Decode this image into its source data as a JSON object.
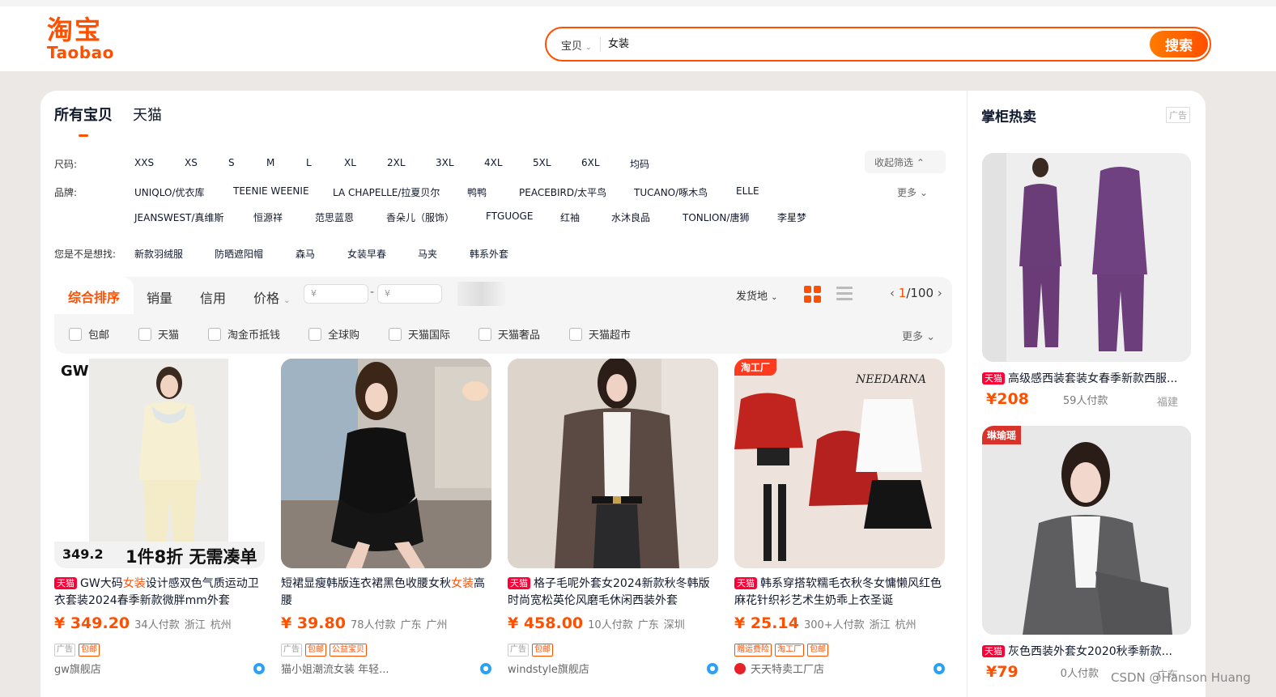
{
  "header": {
    "logo_cn": "淘宝",
    "logo_en": "Taobao",
    "search_type": "宝贝",
    "search_value": "女装",
    "search_button": "搜索"
  },
  "tabs": [
    "所有宝贝",
    "天猫"
  ],
  "filters": {
    "size_label": "尺码:",
    "sizes": [
      "XXS",
      "XS",
      "S",
      "M",
      "L",
      "XL",
      "2XL",
      "3XL",
      "4XL",
      "5XL",
      "6XL",
      "均码"
    ],
    "collapse_label": "收起筛选",
    "brand_label": "品牌:",
    "brands_row1": [
      "UNIQLO/优衣库",
      "TEENIE WEENIE",
      "LA CHAPELLE/拉夏贝尔",
      "鸭鸭",
      "PEACEBIRD/太平鸟",
      "TUCANO/啄木鸟",
      "ELLE"
    ],
    "brands_row2": [
      "JEANSWEST/真维斯",
      "恒源祥",
      "范思蓝恩",
      "香朵儿（服饰）",
      "FTGUOGE",
      "红袖",
      "水沐良品",
      "TONLION/唐狮",
      "李星梦"
    ],
    "brand_more": "更多",
    "suggest_label": "您是不是想找:",
    "suggestions": [
      "新款羽绒服",
      "防晒遮阳帽",
      "森马",
      "女装早春",
      "马夹",
      "韩系外套"
    ]
  },
  "sortbar": {
    "items": [
      "综合排序",
      "销量",
      "信用",
      "价格"
    ],
    "price_min_placeholder": "¥",
    "price_max_placeholder": "¥",
    "ship_label": "发货地",
    "page_current": "1",
    "page_total": "/100",
    "checkboxes": [
      "包邮",
      "天猫",
      "淘金币抵钱",
      "全球购",
      "天猫国际",
      "天猫奢品",
      "天猫超市"
    ],
    "more": "更多"
  },
  "products": [
    {
      "tag": "天猫",
      "title_pre": "GW大码",
      "title_kw": "女装",
      "title_post": "设计感双色气质运动卫衣套装2024春季新款微胖mm外套",
      "price": "¥ 349.20",
      "sales": "34人付款",
      "province": "浙江",
      "city": "杭州",
      "badges": [
        "广告",
        "包邮"
      ],
      "shop": "gw旗舰店",
      "img_brand": "GW",
      "img_price": "349.2",
      "img_promo": "1件8折 无需凑单"
    },
    {
      "tag": "",
      "title_pre": "短裙显瘦韩版连衣裙黑色收腰女秋",
      "title_kw": "女装",
      "title_post": "高腰",
      "price": "¥ 39.80",
      "sales": "78人付款",
      "province": "广东",
      "city": "广州",
      "badges": [
        "广告",
        "包邮",
        "公益宝贝"
      ],
      "shop": "猫小姐潮流女装 年轻..."
    },
    {
      "tag": "天猫",
      "title_pre": "格子毛呢外套女2024新款秋冬韩版时尚宽松英伦风磨毛休闲西装外套",
      "title_kw": "",
      "title_post": "",
      "price": "¥ 458.00",
      "sales": "10人付款",
      "province": "广东",
      "city": "深圳",
      "badges": [
        "广告",
        "包邮"
      ],
      "shop": "windstyle旗舰店"
    },
    {
      "tag": "天猫",
      "title_pre": "韩系穿搭软糯毛衣秋冬女慵懒风红色麻花针织衫艺术生奶乖上衣圣诞",
      "title_kw": "",
      "title_post": "",
      "price": "¥ 25.14",
      "sales": "300+人付款",
      "province": "浙江",
      "city": "杭州",
      "badges": [
        "赠运费险",
        "淘工厂",
        "包邮"
      ],
      "shop": "天天特卖工厂店",
      "img_label": "淘工厂",
      "img_brand": "NEEDARNA"
    }
  ],
  "aside": {
    "title": "掌柜热卖",
    "ad": "广告",
    "items": [
      {
        "tag": "天猫",
        "title": "高级感西装套装女春季新款西服...",
        "price": "¥208",
        "sales": "59人付款",
        "loc": "福建"
      },
      {
        "tag": "天猫",
        "title": "灰色西装外套女2020秋季新款...",
        "price": "¥79",
        "sales": "0人付款",
        "loc": "广东",
        "img_label": "琳瑜瑶"
      }
    ]
  },
  "watermark": "CSDN @Hanson Huang",
  "colors": {
    "brand": "#ff5000",
    "tmall": "#ff0036"
  }
}
